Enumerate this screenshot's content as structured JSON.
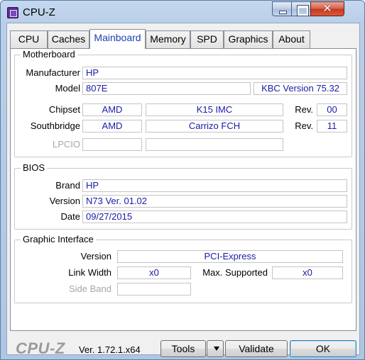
{
  "window": {
    "title": "CPU-Z"
  },
  "tabs": [
    {
      "label": "CPU"
    },
    {
      "label": "Caches"
    },
    {
      "label": "Mainboard"
    },
    {
      "label": "Memory"
    },
    {
      "label": "SPD"
    },
    {
      "label": "Graphics"
    },
    {
      "label": "About"
    }
  ],
  "active_tab": "Mainboard",
  "motherboard": {
    "group_label": "Motherboard",
    "manufacturer_label": "Manufacturer",
    "manufacturer": "HP",
    "model_label": "Model",
    "model": "807E",
    "model_version": "KBC Version 75.32",
    "chipset_label": "Chipset",
    "chipset_vendor": "AMD",
    "chipset_name": "K15 IMC",
    "rev_label": "Rev.",
    "chipset_rev": "00",
    "southbridge_label": "Southbridge",
    "southbridge_vendor": "AMD",
    "southbridge_name": "Carrizo FCH",
    "southbridge_rev": "11",
    "lpcio_label": "LPCIO"
  },
  "bios": {
    "group_label": "BIOS",
    "brand_label": "Brand",
    "brand": "HP",
    "version_label": "Version",
    "version": "N73 Ver. 01.02",
    "date_label": "Date",
    "date": "09/27/2015"
  },
  "graphic_interface": {
    "group_label": "Graphic Interface",
    "version_label": "Version",
    "version": "PCI-Express",
    "link_width_label": "Link Width",
    "link_width": "x0",
    "max_supported_label": "Max. Supported",
    "max_supported": "x0",
    "side_band_label": "Side Band"
  },
  "footer": {
    "logo": "CPU-Z",
    "version": "Ver. 1.72.1.x64",
    "tools_label": "Tools",
    "validate_label": "Validate",
    "ok_label": "OK"
  },
  "colors": {
    "value_text": "#1a1aa6",
    "active_tab_text": "#1a3fb0",
    "close_button": "#c7381d"
  }
}
